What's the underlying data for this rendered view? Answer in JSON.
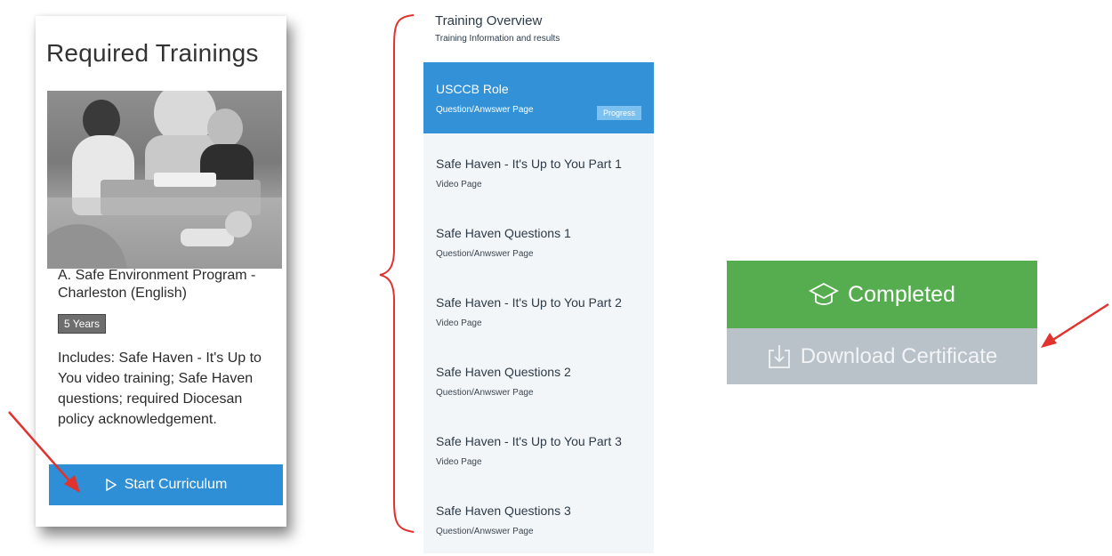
{
  "card": {
    "title": "Required Trainings",
    "course_title": "A. Safe Environment Program - Charleston (English)",
    "badge": "5 Years",
    "description": "Includes: Safe Haven - It's Up to You video training; Safe Haven questions; required Diocesan policy acknowledgement.",
    "start_button": "Start Curriculum",
    "start_icon": "play-outline-icon",
    "accent_color": "#2f8fd6"
  },
  "overview": {
    "title": "Training Overview",
    "subtitle": "Training Information and results"
  },
  "list": {
    "items": [
      {
        "title": "USCCB Role",
        "subtitle": "Question/Anwswer Page",
        "badge": "Progress",
        "active": true
      },
      {
        "title": "Safe Haven - It's Up to You Part 1",
        "subtitle": "Video Page"
      },
      {
        "title": "Safe Haven Questions 1",
        "subtitle": "Question/Anwswer Page"
      },
      {
        "title": "Safe Haven - It's Up to You Part 2",
        "subtitle": "Video Page"
      },
      {
        "title": "Safe Haven Questions 2",
        "subtitle": "Question/Anwswer Page"
      },
      {
        "title": "Safe Haven - It's Up to You Part 3",
        "subtitle": "Video Page"
      },
      {
        "title": "Safe Haven Questions 3",
        "subtitle": "Question/Anwswer Page"
      }
    ],
    "active_color": "#3392d7"
  },
  "status": {
    "completed_label": "Completed",
    "completed_icon": "graduation-cap-icon",
    "completed_color": "#55ad4f",
    "download_label": "Download Certificate",
    "download_icon": "download-icon",
    "download_color": "#b9c1c9"
  },
  "annotation_color": "#e0322e"
}
